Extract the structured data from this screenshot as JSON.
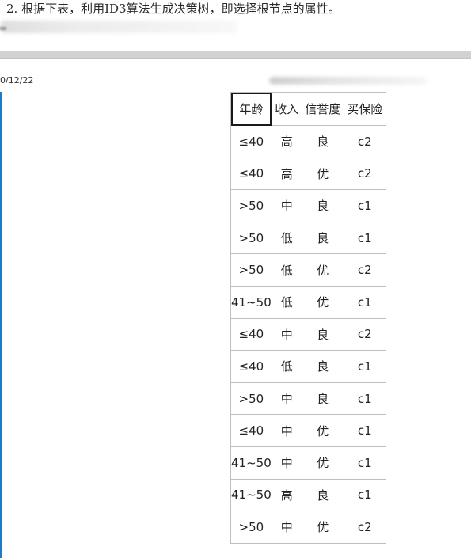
{
  "question": {
    "text": "2. 根据下表，利用ID3算法生成决策树，即选择根节点的属性。"
  },
  "meta": {
    "date": "0/12/22"
  },
  "table": {
    "headers": [
      "年龄",
      "收入",
      "信誉度",
      "买保险"
    ],
    "rows": [
      [
        "≤40",
        "高",
        "良",
        "c2"
      ],
      [
        "≤40",
        "高",
        "优",
        "c2"
      ],
      [
        ">50",
        "中",
        "良",
        "c1"
      ],
      [
        ">50",
        "低",
        "良",
        "c1"
      ],
      [
        ">50",
        "低",
        "优",
        "c2"
      ],
      [
        "41~50",
        "低",
        "优",
        "c1"
      ],
      [
        "≤40",
        "中",
        "良",
        "c2"
      ],
      [
        "≤40",
        "低",
        "良",
        "c1"
      ],
      [
        ">50",
        "中",
        "良",
        "c1"
      ],
      [
        "≤40",
        "中",
        "优",
        "c1"
      ],
      [
        "41~50",
        "中",
        "优",
        "c1"
      ],
      [
        "41~50",
        "高",
        "良",
        "c1"
      ],
      [
        ">50",
        "中",
        "优",
        "c2"
      ]
    ]
  },
  "colors": {
    "accent": "#1f7bc6",
    "divider": "#d2d2d2",
    "table_border": "#bfbfbf"
  }
}
